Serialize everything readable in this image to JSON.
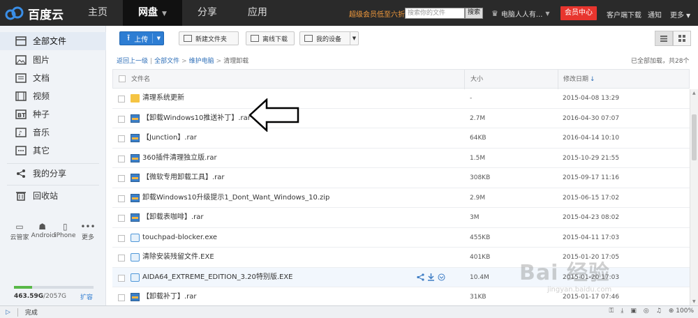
{
  "app": {
    "title": "百度云"
  },
  "nav": {
    "items": [
      {
        "label": "主页"
      },
      {
        "label": "网盘",
        "active": true
      },
      {
        "label": "分享"
      },
      {
        "label": "应用"
      }
    ]
  },
  "topbar": {
    "promo": "超级会员低至六折",
    "search_placeholder": "搜索你的文件",
    "search_button": "搜索",
    "user_name": "电脑人人有...",
    "vip_button": "会员中心",
    "client_download": "客户端下载",
    "notifications": "通知",
    "more": "更多"
  },
  "sidebar": {
    "items": [
      {
        "label": "全部文件",
        "icon": "all-files-icon"
      },
      {
        "label": "图片",
        "icon": "image-icon"
      },
      {
        "label": "文档",
        "icon": "document-icon"
      },
      {
        "label": "视频",
        "icon": "video-icon"
      },
      {
        "label": "种子",
        "icon": "bt-icon"
      },
      {
        "label": "音乐",
        "icon": "music-icon"
      },
      {
        "label": "其它",
        "icon": "other-icon"
      },
      {
        "label": "我的分享",
        "icon": "share-icon"
      },
      {
        "label": "回收站",
        "icon": "trash-icon"
      }
    ],
    "devices": [
      {
        "label": "云管家",
        "icon": "monitor-icon"
      },
      {
        "label": "Android",
        "icon": "android-icon"
      },
      {
        "label": "iPhone",
        "icon": "iphone-icon"
      },
      {
        "label": "更多",
        "icon": "more-dots-icon"
      }
    ],
    "quota_used": "463.59G",
    "quota_total": "/2057G",
    "quota_fraction": 0.225,
    "expand": "扩容"
  },
  "toolbar": {
    "upload": "上传",
    "new_folder": "新建文件夹",
    "offline_download": "离线下载",
    "my_devices": "我的设备"
  },
  "breadcrumb": {
    "back": "返回上一级",
    "all_files": "全部文件",
    "parent": "维护电脑",
    "current": "清理卸载",
    "loaded_status": "已全部加载，共28个"
  },
  "table": {
    "headers": {
      "name": "文件名",
      "size": "大小",
      "date": "修改日期"
    },
    "rows": [
      {
        "name": "清理系统更新",
        "type": "folder",
        "size": "-",
        "date": "2015-04-08 13:29"
      },
      {
        "name": "【卸载Windows10推送补丁】.rar",
        "type": "rar",
        "size": "2.7M",
        "date": "2016-04-30 07:07"
      },
      {
        "name": "【Junction】.rar",
        "type": "rar",
        "size": "64KB",
        "date": "2016-04-14 10:10"
      },
      {
        "name": "360插件清理独立版.rar",
        "type": "rar",
        "size": "1.5M",
        "date": "2015-10-29 21:55"
      },
      {
        "name": "【微软专用卸载工具】.rar",
        "type": "rar",
        "size": "308KB",
        "date": "2015-09-17 11:16"
      },
      {
        "name": "卸载Windows10升级提示1_Dont_Want_Windows_10.zip",
        "type": "rar",
        "size": "2.9M",
        "date": "2015-06-15 17:02"
      },
      {
        "name": "【卸载表咖啡】.rar",
        "type": "rar",
        "size": "3M",
        "date": "2015-04-23 08:02"
      },
      {
        "name": "touchpad-blocker.exe",
        "type": "exe",
        "size": "455KB",
        "date": "2015-04-11 17:03"
      },
      {
        "name": "清除安装残留文件.EXE",
        "type": "exe",
        "size": "401KB",
        "date": "2015-01-20 17:05"
      },
      {
        "name": "AIDA64_EXTREME_EDITION_3.20特别版.EXE",
        "type": "exe",
        "size": "10.4M",
        "date": "2015-01-20 17:03"
      },
      {
        "name": "【卸载补丁】.rar",
        "type": "rar",
        "size": "31KB",
        "date": "2015-01-17 07:46"
      }
    ]
  },
  "statusbar": {
    "status": "完成",
    "zoom": "100%"
  },
  "watermark": {
    "main": "Bai 经验",
    "sub": "jingyan.baidu.com"
  },
  "colors": {
    "topbar": "#2a2a2a",
    "accent_blue": "#2d7dd3",
    "vip_red": "#e8352e",
    "promo_orange": "#f39a3c",
    "quota_green": "#59b848"
  }
}
